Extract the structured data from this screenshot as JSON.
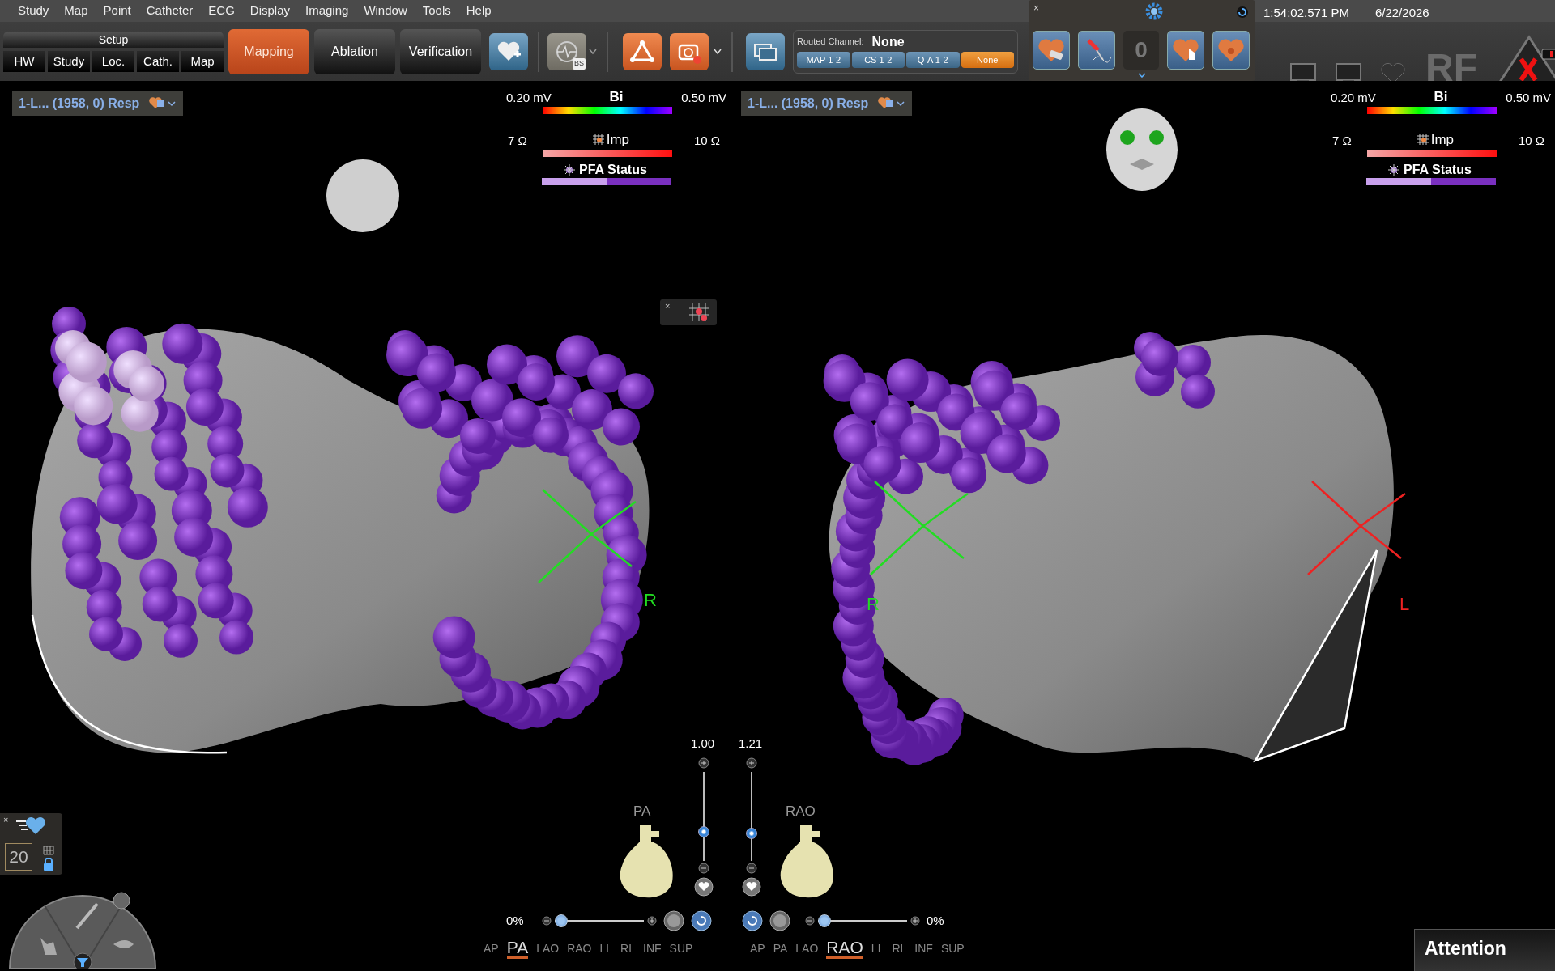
{
  "menu": [
    "Study",
    "Map",
    "Point",
    "Catheter",
    "ECG",
    "Display",
    "Imaging",
    "Window",
    "Tools",
    "Help"
  ],
  "setup": {
    "title": "Setup",
    "tabs": [
      "HW",
      "Study",
      "Loc.",
      "Cath.",
      "Map"
    ]
  },
  "workflow_tabs": [
    {
      "label": "Mapping",
      "selected": true
    },
    {
      "label": "Ablation",
      "selected": false
    },
    {
      "label": "Verification",
      "selected": false
    }
  ],
  "routed_channel": {
    "label": "Routed Channel:",
    "value": "None",
    "channels": [
      {
        "label": "MAP 1-2",
        "selected": false
      },
      {
        "label": "CS 1-2",
        "selected": false
      },
      {
        "label": "Q-A 1-2",
        "selected": false
      },
      {
        "label": "None",
        "selected": true
      }
    ]
  },
  "bs_label": "BS",
  "floating_panel_close": "×",
  "grid_widget_close": "×",
  "frame_widget_close": "×",
  "counter": "0",
  "clock": {
    "time": "1:54:02.571 PM",
    "date": "6/22/2026"
  },
  "rf_label": "RF",
  "views": [
    {
      "map_selector": "1-L... (1958, 0) Resp",
      "orientation_head": {
        "kind": "back"
      },
      "bi": {
        "min": "0.20 mV",
        "label": "Bi",
        "max": "0.50 mV"
      },
      "imp": {
        "min": "7 Ω",
        "label": "Imp",
        "max": "10 Ω"
      },
      "pfa": {
        "label": "PFA Status"
      },
      "catheters": [
        {
          "label": "R",
          "color": "#22dd22"
        }
      ],
      "zoom": {
        "value": "1.00",
        "level": 0.3
      },
      "transparency": {
        "value": "0%",
        "level": 0
      },
      "orientation_label": "PA",
      "orientations": [
        {
          "label": "AP",
          "selected": false
        },
        {
          "label": "PA",
          "selected": true
        },
        {
          "label": "LAO",
          "selected": false
        },
        {
          "label": "RAO",
          "selected": false
        },
        {
          "label": "LL",
          "selected": false
        },
        {
          "label": "RL",
          "selected": false
        },
        {
          "label": "INF",
          "selected": false
        },
        {
          "label": "SUP",
          "selected": false
        }
      ]
    },
    {
      "map_selector": "1-L... (1958, 0) Resp",
      "orientation_head": {
        "kind": "face"
      },
      "bi": {
        "min": "0.20 mV",
        "label": "Bi",
        "max": "0.50 mV"
      },
      "imp": {
        "min": "7 Ω",
        "label": "Imp",
        "max": "10 Ω"
      },
      "pfa": {
        "label": "PFA Status"
      },
      "catheters": [
        {
          "label": "R",
          "color": "#22dd22"
        },
        {
          "label": "L",
          "color": "#ee2222"
        }
      ],
      "zoom": {
        "value": "1.21",
        "level": 0.28
      },
      "transparency": {
        "value": "0%",
        "level": 0
      },
      "orientation_label": "RAO",
      "orientations": [
        {
          "label": "AP",
          "selected": false
        },
        {
          "label": "PA",
          "selected": false
        },
        {
          "label": "LAO",
          "selected": false
        },
        {
          "label": "RAO",
          "selected": true
        },
        {
          "label": "LL",
          "selected": false
        },
        {
          "label": "RL",
          "selected": false
        },
        {
          "label": "INF",
          "selected": false
        },
        {
          "label": "SUP",
          "selected": false
        }
      ]
    }
  ],
  "frame_counter": "20",
  "attention": "Attention"
}
